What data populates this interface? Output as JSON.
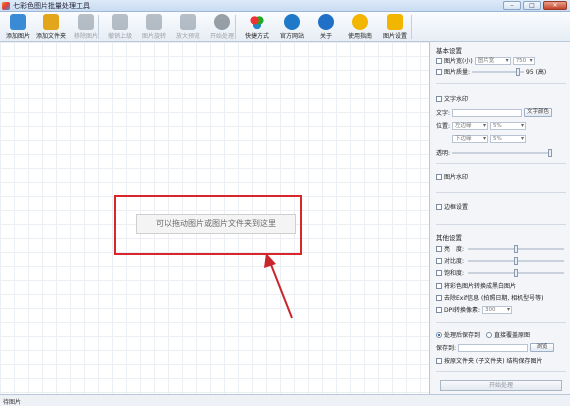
{
  "window": {
    "title": "七彩色图片批量处理工具",
    "controls": {
      "minimize": "–",
      "maximize": "□",
      "close": "✕"
    }
  },
  "toolbar": {
    "items": [
      {
        "label": "添加图片",
        "icon": "add-image-icon",
        "disabled": false,
        "color": "#3a8ad6"
      },
      {
        "label": "添加文件夹",
        "icon": "add-folder-icon",
        "disabled": false,
        "color": "#e3a51c"
      },
      {
        "label": "移除图片",
        "icon": "remove-image-icon",
        "disabled": true,
        "color": "#7f8c99"
      },
      {
        "label": "撤销上级",
        "icon": "undo-icon",
        "disabled": true,
        "color": "#7f8c99"
      },
      {
        "label": "图片旋转",
        "icon": "rotate-icon",
        "disabled": true,
        "color": "#7f8c99"
      },
      {
        "label": "放大预览",
        "icon": "zoom-icon",
        "disabled": true,
        "color": "#7f8c99"
      },
      {
        "label": "开始处理",
        "icon": "start-process-icon",
        "disabled": true,
        "color": "#4b5561"
      },
      {
        "label": "快捷方式",
        "icon": "shortcut-icon",
        "disabled": false,
        "color": "#2fae3c"
      },
      {
        "label": "官方网站",
        "icon": "website-icon",
        "disabled": false,
        "color": "#1f78c8"
      },
      {
        "label": "关于",
        "icon": "about-icon",
        "disabled": false,
        "color": "#2070c8"
      },
      {
        "label": "使用指南",
        "icon": "guide-icon",
        "disabled": false,
        "color": "#f2b500"
      },
      {
        "label": "图片设置",
        "icon": "settings-icon",
        "disabled": false,
        "color": "#f2b500"
      }
    ]
  },
  "canvas": {
    "drop_hint": "可以拖动图片或图片文件夹到这里"
  },
  "panel": {
    "basic": {
      "section": "基本设置",
      "width_label": "图片宽(小)",
      "width_unit_select": "图片宽",
      "width_value": "750",
      "quality_label": "图片质量:",
      "quality_value": "95 (高)"
    },
    "watermark": {
      "section": "文字水印",
      "text_label": "文字:",
      "font_button": "文字颜色",
      "position_label": "位置:",
      "h_align": "左边缘",
      "h_value": "5%",
      "v_align": "下边缘",
      "v_value": "5%",
      "opacity_label": "透明:"
    },
    "image_watermark": {
      "section": "图片水印"
    },
    "border": {
      "section": "边框设置"
    },
    "other": {
      "section": "其他设置",
      "brightness_label": "亮　度:",
      "contrast_label": "对比度:",
      "saturation_label": "饱和度:",
      "grayscale_label": "将彩色图片转换成黑白图片",
      "exif_label": "去除Exif信息 (拍照日期, 相机型号等)",
      "dpi_label": "DPI转换像素:",
      "dpi_value": "300"
    },
    "output": {
      "keep_original_label": "处理后保存到",
      "overwrite_label": "直接覆盖原图",
      "save_to_label": "保存到:",
      "browse_button": "浏览",
      "keep_structure_label": "按原文件夹 (子文件夹) 结构保存图片"
    },
    "start_button": "开始处理"
  },
  "statusbar": {
    "text": "待图片"
  }
}
